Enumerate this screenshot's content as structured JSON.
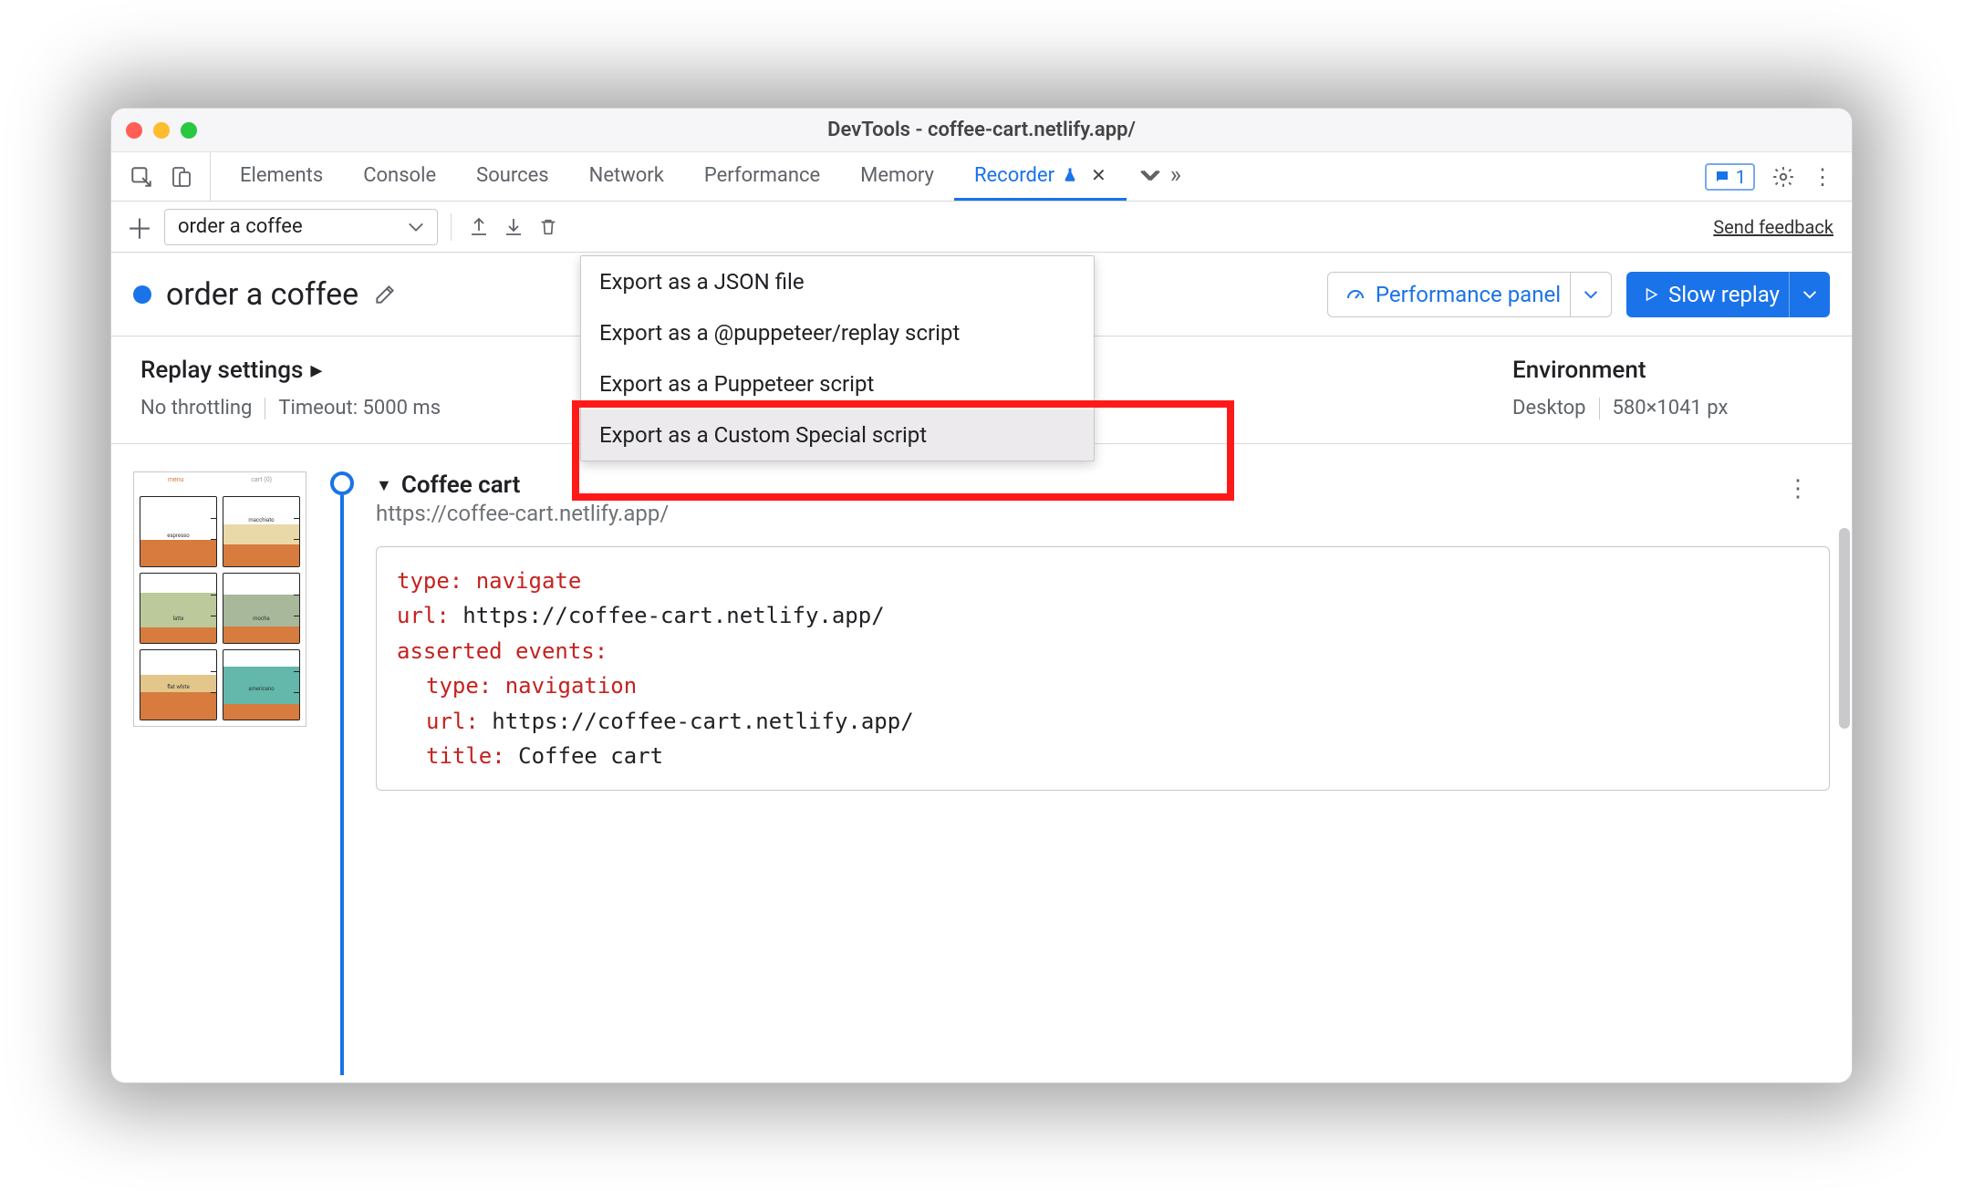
{
  "window": {
    "title": "DevTools - coffee-cart.netlify.app/"
  },
  "tabs": {
    "items": [
      "Elements",
      "Console",
      "Sources",
      "Network",
      "Performance",
      "Memory",
      "Recorder"
    ],
    "active_index": 6,
    "issues_count": "1"
  },
  "toolbar": {
    "recording_select": "order a coffee",
    "send_feedback": "Send feedback"
  },
  "header": {
    "title": "order a coffee",
    "perf_panel": "Performance panel",
    "slow_replay": "Slow replay"
  },
  "settings": {
    "title": "Replay settings",
    "throttling": "No throttling",
    "timeout": "Timeout: 5000 ms",
    "env_title": "Environment",
    "env_device": "Desktop",
    "env_dims": "580×1041 px"
  },
  "export_menu": {
    "items": [
      "Export as a JSON file",
      "Export as a @puppeteer/replay script",
      "Export as a Puppeteer script",
      "Export as a Custom Special script"
    ],
    "hover_index": 3
  },
  "step": {
    "title": "Coffee cart",
    "url": "https://coffee-cart.netlify.app/",
    "code": {
      "l1k": "type",
      "l1v": "navigate",
      "l2k": "url",
      "l2v": "https://coffee-cart.netlify.app/",
      "l3k": "asserted events",
      "l4k": "type",
      "l4v": "navigation",
      "l5k": "url",
      "l5v": "https://coffee-cart.netlify.app/",
      "l6k": "title",
      "l6v": "Coffee cart"
    }
  }
}
